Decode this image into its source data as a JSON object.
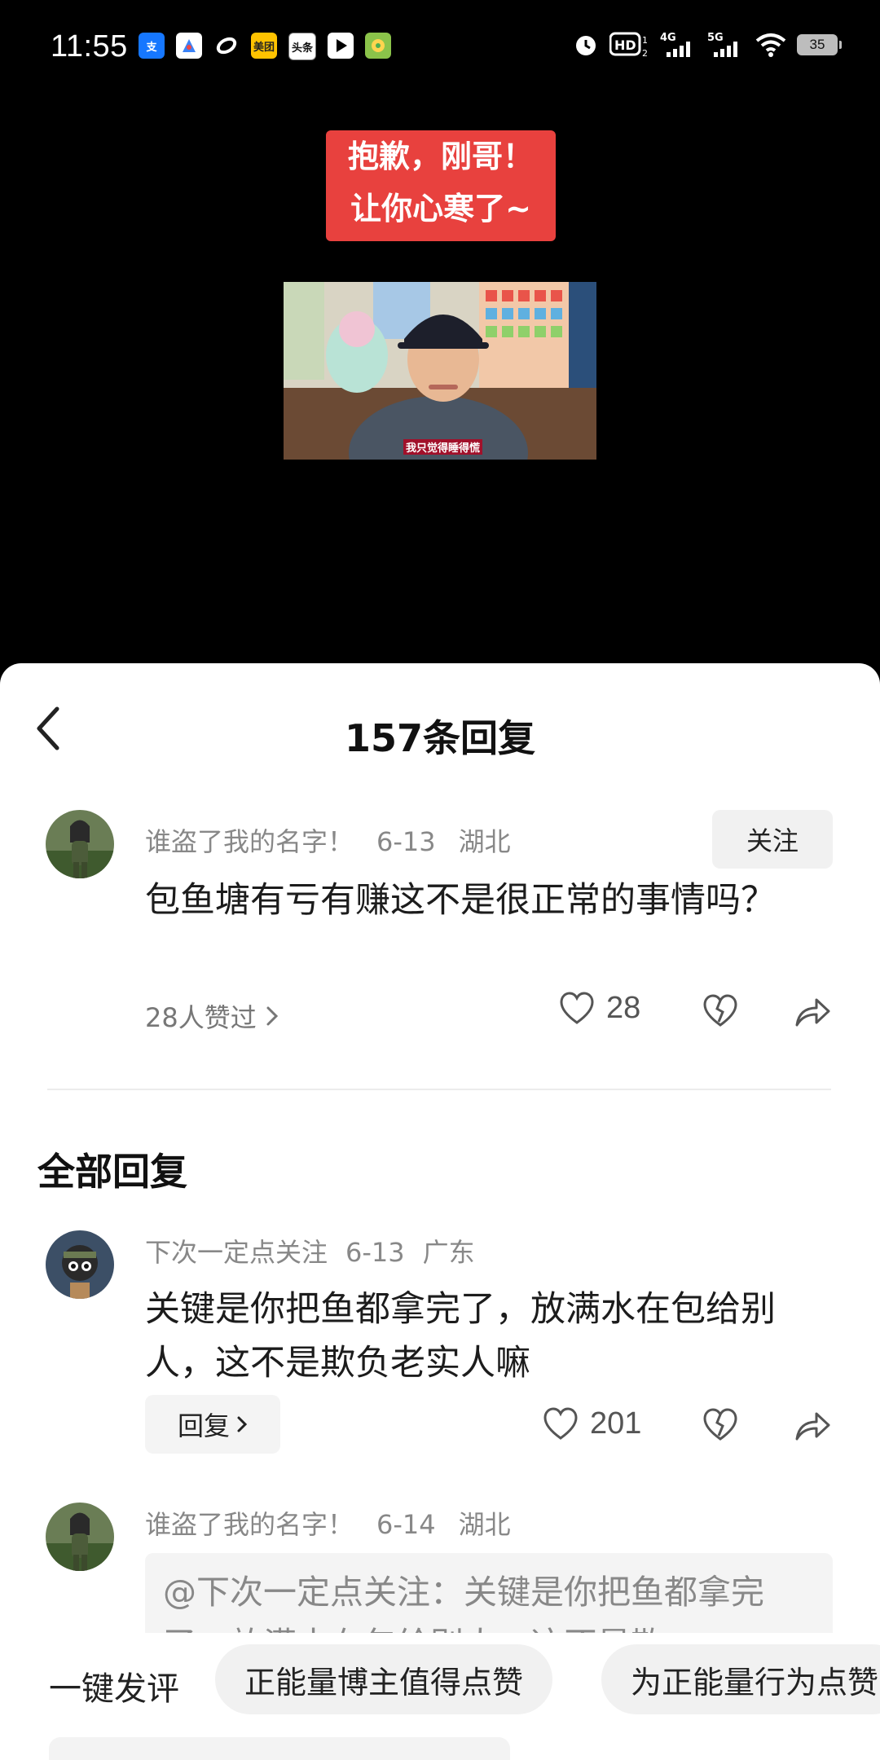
{
  "status": {
    "time": "11:55",
    "apps": [
      {
        "icon": "alipay-icon",
        "label": "支",
        "color": "#1677ff"
      },
      {
        "icon": "rocket-app-icon",
        "label": "",
        "color": "#3b82f6"
      },
      {
        "icon": "swirl-app-icon",
        "label": "",
        "color": "#ffffff"
      },
      {
        "icon": "meituan-icon",
        "label": "美团",
        "color": "#ffc300"
      },
      {
        "icon": "toutiao-icon",
        "label": "头条",
        "color": "#ffffff"
      },
      {
        "icon": "video-play-icon",
        "label": "",
        "color": "#ffffff"
      },
      {
        "icon": "music-app-icon",
        "label": "",
        "color": "#8bc34a"
      }
    ],
    "battery": "35"
  },
  "video": {
    "banner_line1": "抱歉，刚哥！",
    "banner_line2": "让你心寒了~",
    "caption": "我只觉得睡得慌"
  },
  "sheet": {
    "title": "157条回复",
    "main_comment": {
      "user": "谁盗了我的名字！",
      "date": "6-13",
      "location": "湖北",
      "follow_label": "关注",
      "text": "包鱼塘有亏有赚这不是很正常的事情吗？",
      "liked_by": "28人赞过",
      "like_count": "28"
    },
    "section_title": "全部回复",
    "replies": [
      {
        "user": "下次一定点关注",
        "date": "6-13",
        "location": "广东",
        "text": "关键是你把鱼都拿完了，放满水在包给别人，这不是欺负老实人嘛",
        "reply_label": "回复",
        "like_count": "201"
      },
      {
        "user": "谁盗了我的名字！",
        "date": "6-14",
        "location": "湖北",
        "text": "@下次一定点关注：关键是你把鱼都拿完了，放满水在包给别人，这不是欺"
      }
    ],
    "quick": {
      "label": "一键发评",
      "chips": [
        "正能量博主值得点赞",
        "为正能量行为点赞"
      ]
    }
  }
}
